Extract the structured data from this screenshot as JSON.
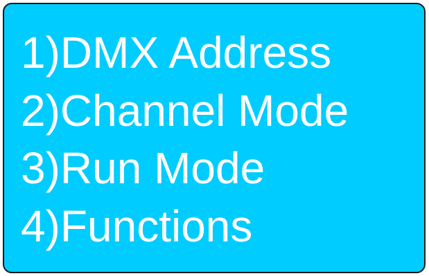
{
  "colors": {
    "screen_background": "#00ccff",
    "text": "#ffffff",
    "border": "#1a1a1a"
  },
  "menu": {
    "items": [
      {
        "label": "1)DMX Address"
      },
      {
        "label": "2)Channel Mode"
      },
      {
        "label": "3)Run Mode"
      },
      {
        "label": "4)Functions"
      }
    ]
  }
}
